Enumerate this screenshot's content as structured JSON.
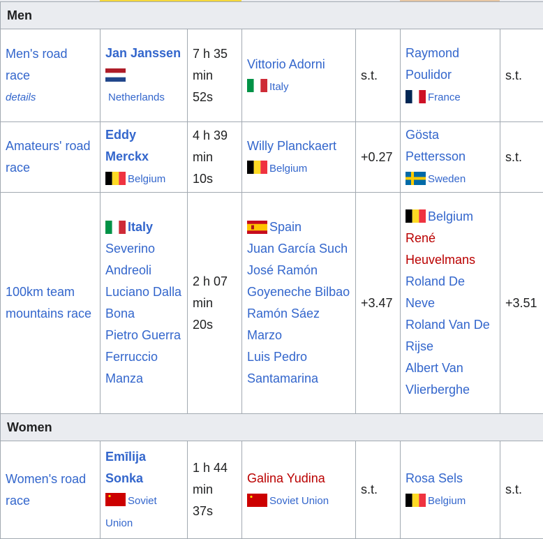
{
  "sections": [
    {
      "title": "Men",
      "rows": [
        {
          "event": "Men's road race",
          "event_note": "details",
          "gold": {
            "name": "Jan Janssen",
            "country": "Netherlands"
          },
          "gold_time": "7 h 35 min 52s",
          "silver": {
            "name": "Vittorio Adorni",
            "country": "Italy"
          },
          "silver_time": "s.t.",
          "bronze": {
            "name": "Raymond Poulidor",
            "country": "France"
          },
          "bronze_time": "s.t."
        },
        {
          "event": "Amateurs' road race",
          "gold": {
            "name": "Eddy Merckx",
            "country": "Belgium"
          },
          "gold_time": "4 h 39 min 10s",
          "silver": {
            "name": "Willy Planckaert",
            "country": "Belgium"
          },
          "silver_time": "+0.27",
          "bronze": {
            "name": "Gösta Pettersson",
            "country": "Sweden"
          },
          "bronze_time": "s.t."
        },
        {
          "event": "100km team mountains race",
          "gold": {
            "team": "Italy",
            "members": [
              "Severino Andreoli",
              "Luciano Dalla Bona",
              "Pietro Guerra",
              "Ferruccio Manza"
            ]
          },
          "gold_time": "2 h 07 min 20s",
          "silver": {
            "team": "Spain",
            "members": [
              "Juan García Such",
              "José Ramón Goyeneche Bilbao",
              "Ramón Sáez Marzo",
              "Luis Pedro Santamarina"
            ]
          },
          "silver_time": "+3.47",
          "bronze": {
            "team": "Belgium",
            "members": [
              "René Heuvelmans",
              "Roland De Neve",
              "Roland Van De Rijse",
              "Albert Van Vlierberghe"
            ]
          },
          "bronze_time": "+3.51"
        }
      ]
    },
    {
      "title": "Women",
      "rows": [
        {
          "event": "Women's road race",
          "gold": {
            "name": "Emīlija Sonka",
            "country": "Soviet Union"
          },
          "gold_time": "1 h 44 min 37s",
          "silver": {
            "name": "Galina Yudina",
            "country": "Soviet Union"
          },
          "silver_time": "s.t.",
          "bronze": {
            "name": "Rosa Sels",
            "country": "Belgium"
          },
          "bronze_time": "s.t."
        }
      ]
    }
  ],
  "colors": {
    "link": "#3366cc",
    "redlink": "#ba0000",
    "header_bg": "#eaecf0",
    "border": "#a2a9b1",
    "gold": "#f5d83b",
    "bronze": "#e6c6a3"
  },
  "flag_icons": [
    "netherlands-flag-icon",
    "italy-flag-icon",
    "france-flag-icon",
    "belgium-flag-icon",
    "sweden-flag-icon",
    "spain-flag-icon",
    "soviet-union-flag-icon"
  ]
}
